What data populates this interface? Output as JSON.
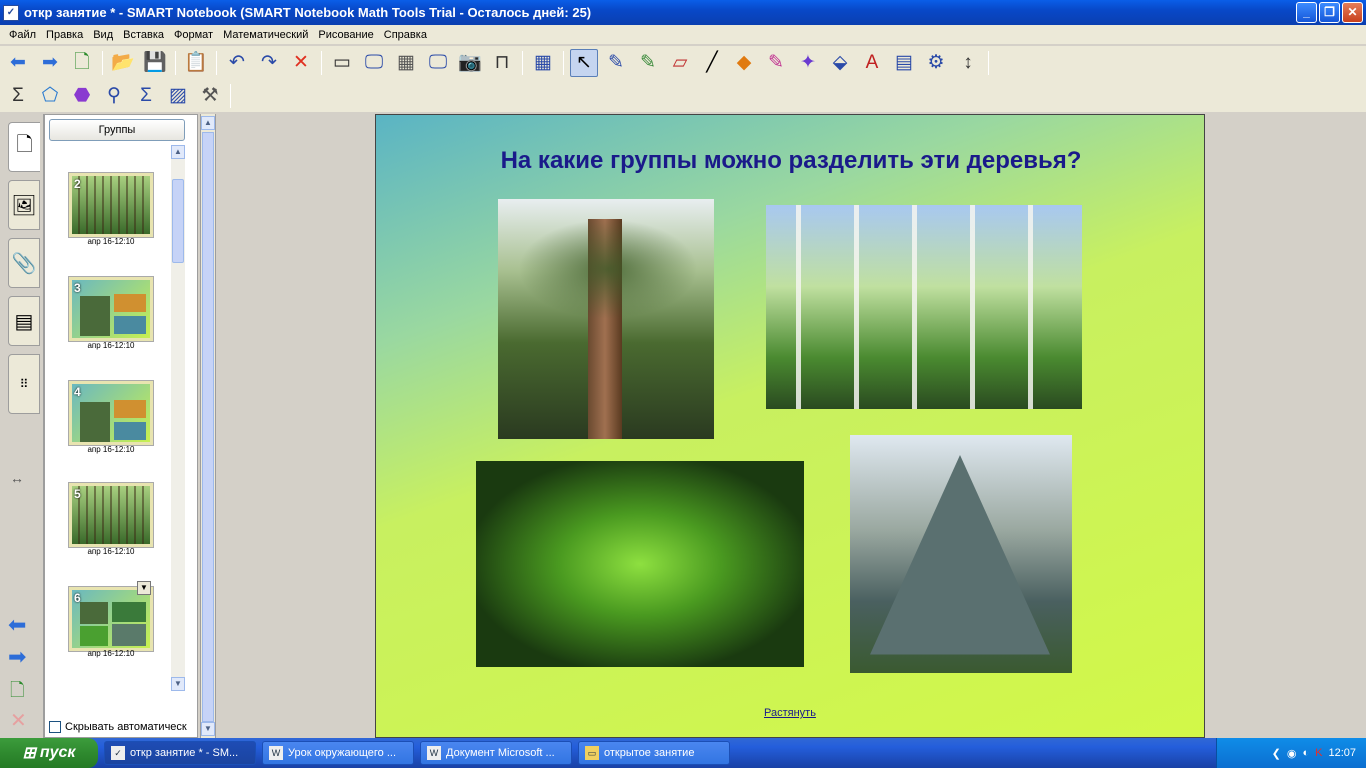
{
  "window": {
    "title": "откр занятие * - SMART Notebook (SMART Notebook Math Tools Trial - Осталось дней: 25)",
    "icon": "notebook-icon"
  },
  "menu": [
    "Файл",
    "Правка",
    "Вид",
    "Вставка",
    "Формат",
    "Математический",
    "Рисование",
    "Справка"
  ],
  "toolbar1": [
    {
      "name": "back-icon",
      "glyph": "⬅",
      "color": "#2d6dd8"
    },
    {
      "name": "forward-icon",
      "glyph": "➡",
      "color": "#2d6dd8"
    },
    {
      "name": "add-page-icon",
      "glyph": "🗋",
      "color": "#2a8a2a"
    },
    {
      "name": "open-icon",
      "glyph": "📂",
      "color": "#d8a020"
    },
    {
      "name": "save-icon",
      "glyph": "💾",
      "color": "#2a4aa8"
    },
    {
      "name": "paste-icon",
      "glyph": "📋",
      "color": "#6a5020"
    },
    {
      "name": "undo-icon",
      "glyph": "↶",
      "color": "#2a4aa8"
    },
    {
      "name": "redo-icon",
      "glyph": "↷",
      "color": "#2a4aa8"
    },
    {
      "name": "delete-icon",
      "glyph": "✕",
      "color": "#e03020"
    },
    {
      "name": "screen-shade-icon",
      "glyph": "▭",
      "color": "#333"
    },
    {
      "name": "full-screen-icon",
      "glyph": "🖵",
      "color": "#2a4aa8"
    },
    {
      "name": "transparent-bg-icon",
      "glyph": "▦",
      "color": "#555"
    },
    {
      "name": "dual-page-icon",
      "glyph": "🖵",
      "color": "#2a4aa8"
    },
    {
      "name": "screen-capture-icon",
      "glyph": "📷",
      "color": "#333"
    },
    {
      "name": "document-camera-icon",
      "glyph": "⊓",
      "color": "#333"
    },
    {
      "name": "table-icon",
      "glyph": "▦",
      "color": "#2a4aa8"
    },
    {
      "name": "select-icon",
      "glyph": "↖",
      "color": "#000",
      "active": true
    },
    {
      "name": "pen-icon",
      "glyph": "✎",
      "color": "#2a4aa8"
    },
    {
      "name": "creative-pen-icon",
      "glyph": "✎",
      "color": "#3a8a3a"
    },
    {
      "name": "eraser-icon",
      "glyph": "▱",
      "color": "#c03030"
    },
    {
      "name": "line-icon",
      "glyph": "╱",
      "color": "#000"
    },
    {
      "name": "shapes-icon",
      "glyph": "◆",
      "color": "#e07a10"
    },
    {
      "name": "fill-pen-icon",
      "glyph": "✎",
      "color": "#c03090"
    },
    {
      "name": "magic-pen-icon",
      "glyph": "✦",
      "color": "#6a3ad0"
    },
    {
      "name": "fill-icon",
      "glyph": "⬙",
      "color": "#2a4aa8"
    },
    {
      "name": "text-icon",
      "glyph": "A",
      "color": "#c02020"
    },
    {
      "name": "properties-icon",
      "glyph": "▤",
      "color": "#2a4aa8"
    },
    {
      "name": "math-tools-icon",
      "glyph": "⚙",
      "color": "#2a4aa8"
    },
    {
      "name": "toolbar-move-icon",
      "glyph": "↕",
      "color": "#333"
    }
  ],
  "toolbar2": [
    {
      "name": "sigma-icon",
      "glyph": "Σ",
      "color": "#333"
    },
    {
      "name": "shape-recognition-icon",
      "glyph": "⬠",
      "color": "#2a7ad0"
    },
    {
      "name": "polygon-icon",
      "glyph": "⬣",
      "color": "#8a3ad0"
    },
    {
      "name": "compass-icon",
      "glyph": "⚲",
      "color": "#2a4aa8"
    },
    {
      "name": "equation-icon",
      "glyph": "Σ",
      "color": "#2a4aa8"
    },
    {
      "name": "graph-icon",
      "glyph": "▨",
      "color": "#2a4aa8"
    },
    {
      "name": "measurement-icon",
      "glyph": "⚒",
      "color": "#555"
    }
  ],
  "panel": {
    "groups_label": "Группы",
    "autohide_label": "Скрывать автоматическ",
    "thumbs": [
      {
        "num": "2",
        "date": "апр 16-12:10"
      },
      {
        "num": "3",
        "date": "апр 16-12:10"
      },
      {
        "num": "4",
        "date": "апр 16-12:10"
      },
      {
        "num": "5",
        "date": "апр 16-12:10"
      },
      {
        "num": "6",
        "date": "апр 16-12:10"
      }
    ]
  },
  "sidetabs": [
    "page-sorter-icon",
    "gallery-icon",
    "attachments-icon",
    "properties-icon"
  ],
  "slide": {
    "title": "На какие группы можно разделить эти деревья?",
    "resize_link": "Растянуть",
    "photos": [
      "pine-tree-photo",
      "birch-forest-photo",
      "maple-sprout-photo",
      "spruce-tree-photo"
    ]
  },
  "taskbar": {
    "start_label": "пуск",
    "tasks": [
      {
        "label": "откр занятие * - SM...",
        "icon": "notebook-icon",
        "active": true
      },
      {
        "label": "Урок окружающего ...",
        "icon": "word-icon",
        "active": false
      },
      {
        "label": "Документ Microsoft ...",
        "icon": "word-icon",
        "active": false
      },
      {
        "label": "открытое занятие",
        "icon": "folder-icon",
        "active": false
      }
    ],
    "lang": "RU",
    "clock": "12:07"
  }
}
